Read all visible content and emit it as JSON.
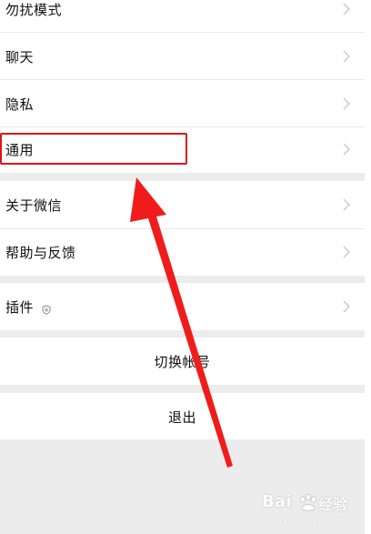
{
  "settings_items": [
    {
      "label": "勿扰模式"
    },
    {
      "label": "聊天"
    },
    {
      "label": "隐私"
    },
    {
      "label": "通用"
    },
    {
      "label": "关于微信"
    },
    {
      "label": "帮助与反馈"
    },
    {
      "label": "插件"
    }
  ],
  "actions": {
    "switch_account": "切换帐号",
    "logout": "退出"
  },
  "annotation": {
    "highlight_color": "#e0141a",
    "arrow_color": "#f01c1c",
    "highlighted_item": "通用"
  },
  "watermark": {
    "brand": "Bai",
    "brand_suffix": "经验",
    "url": "jingyan.baidu.com"
  },
  "colors": {
    "background": "#ececec",
    "surface": "#ffffff",
    "divider": "#e9e9e9",
    "chevron": "#c8c8c8"
  }
}
